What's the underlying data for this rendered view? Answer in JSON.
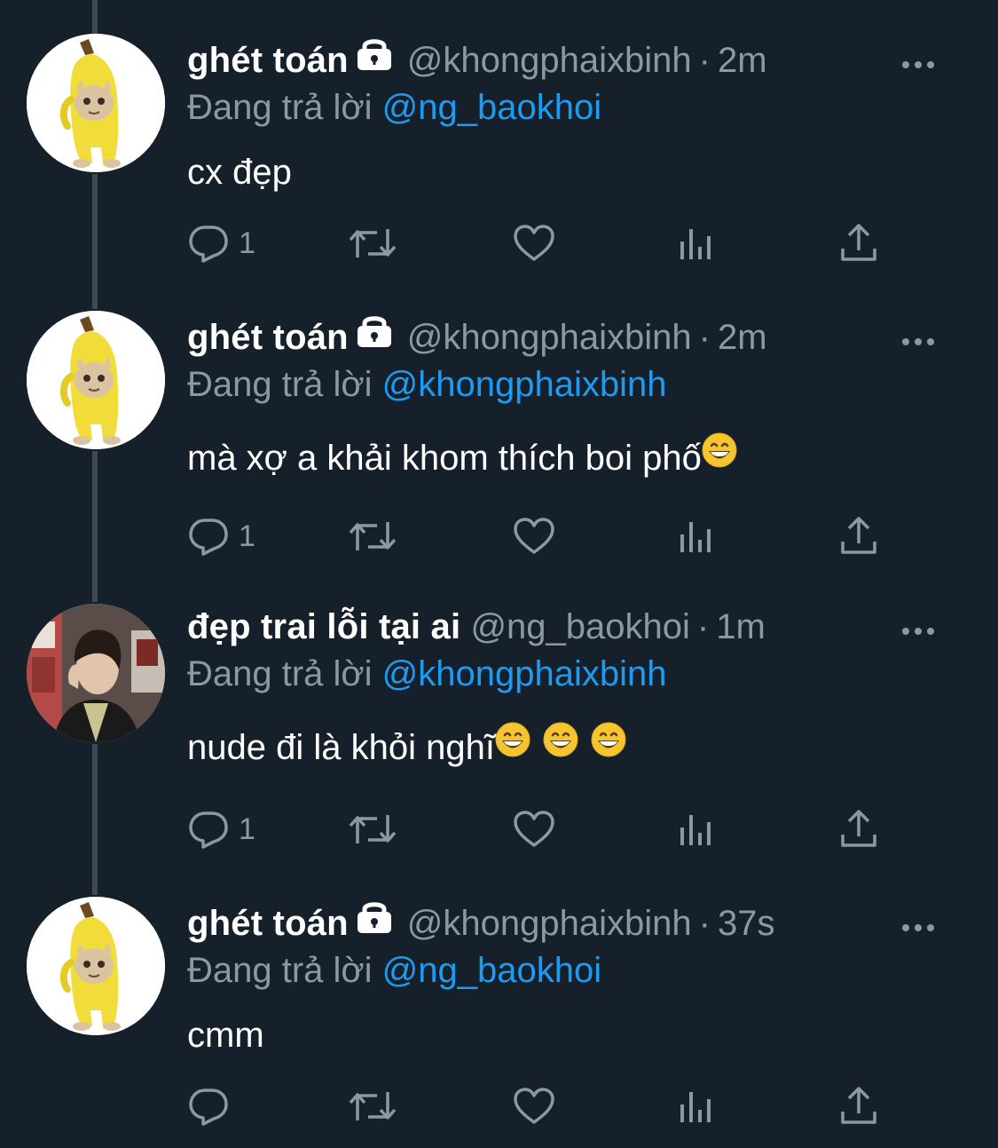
{
  "colors": {
    "background": "#15202b",
    "secondary_text": "#8b98a5",
    "mention": "#1d9bf0",
    "primary_text": "#ffffff"
  },
  "tweets": [
    {
      "display_name": "ghét toán",
      "protected": true,
      "handle": "@khongphaixbinh",
      "separator": "·",
      "time": "2m",
      "reply_prefix": "Đang trả lời",
      "reply_to": "@ng_baokhoi",
      "text": "cx đẹp",
      "emojis": [],
      "reply_count": "1",
      "avatar": "banana-cat-avatar"
    },
    {
      "display_name": "ghét toán",
      "protected": true,
      "handle": "@khongphaixbinh",
      "separator": "·",
      "time": "2m",
      "reply_prefix": "Đang trả lời",
      "reply_to": "@khongphaixbinh",
      "text": "mà xợ a khải khom thích boi phố",
      "emojis": [
        "grinning-face-emoji"
      ],
      "reply_count": "1",
      "avatar": "banana-cat-avatar"
    },
    {
      "display_name": "đẹp trai lỗi tại ai",
      "protected": false,
      "handle": "@ng_baokhoi",
      "separator": "·",
      "time": "1m",
      "reply_prefix": "Đang trả lời",
      "reply_to": "@khongphaixbinh",
      "text": "nude đi là khỏi nghĩ",
      "emojis": [
        "grinning-face-emoji",
        "grinning-face-emoji",
        "grinning-face-emoji"
      ],
      "reply_count": "1",
      "avatar": "person-photo-avatar"
    },
    {
      "display_name": "ghét toán",
      "protected": true,
      "handle": "@khongphaixbinh",
      "separator": "·",
      "time": "37s",
      "reply_prefix": "Đang trả lời",
      "reply_to": "@ng_baokhoi",
      "text": "cmm",
      "emojis": [],
      "reply_count": "",
      "avatar": "banana-cat-avatar"
    }
  ]
}
